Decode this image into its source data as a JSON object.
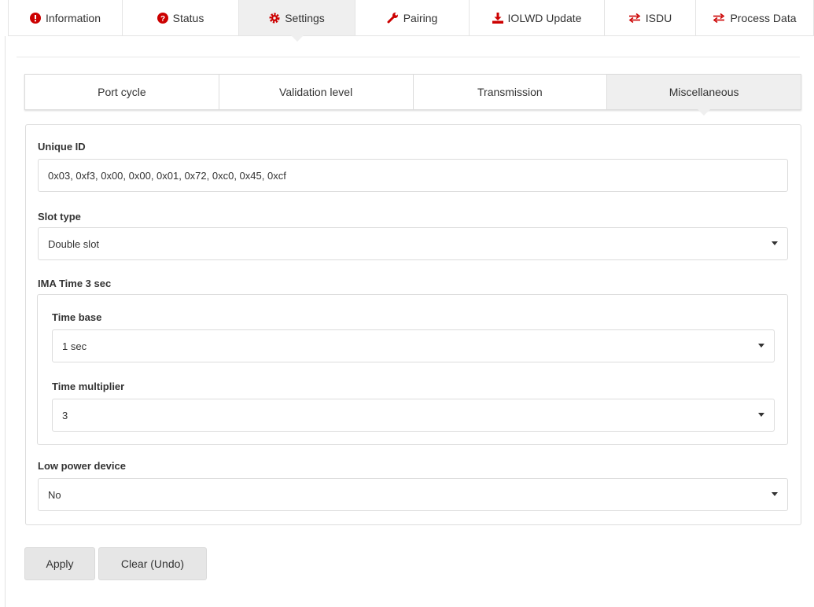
{
  "top_tabs": [
    {
      "label": "Information",
      "icon": "exclamation-circle-icon"
    },
    {
      "label": "Status",
      "icon": "question-circle-icon"
    },
    {
      "label": "Settings",
      "icon": "gear-icon",
      "active": true
    },
    {
      "label": "Pairing",
      "icon": "wrench-icon"
    },
    {
      "label": "IOLWD Update",
      "icon": "download-icon"
    },
    {
      "label": "ISDU",
      "icon": "exchange-icon"
    },
    {
      "label": "Process Data",
      "icon": "exchange-icon"
    }
  ],
  "sub_tabs": [
    {
      "label": "Port cycle"
    },
    {
      "label": "Validation level"
    },
    {
      "label": "Transmission"
    },
    {
      "label": "Miscellaneous",
      "active": true
    }
  ],
  "form": {
    "unique_id": {
      "label": "Unique ID",
      "value": "0x03, 0xf3, 0x00, 0x00, 0x01, 0x72, 0xc0, 0x45, 0xcf"
    },
    "slot_type": {
      "label": "Slot type",
      "value": "Double slot"
    },
    "ima_time": {
      "label": "IMA Time 3 sec"
    },
    "time_base": {
      "label": "Time base",
      "value": "1 sec"
    },
    "time_multiplier": {
      "label": "Time multiplier",
      "value": "3"
    },
    "low_power": {
      "label": "Low power device",
      "value": "No"
    }
  },
  "buttons": {
    "apply": "Apply",
    "clear": "Clear (Undo)"
  },
  "colors": {
    "icon_red": "#cc0000",
    "active_tab_bg": "#efefef",
    "border": "#dcdcdc",
    "button_bg": "#e6e6e6"
  }
}
